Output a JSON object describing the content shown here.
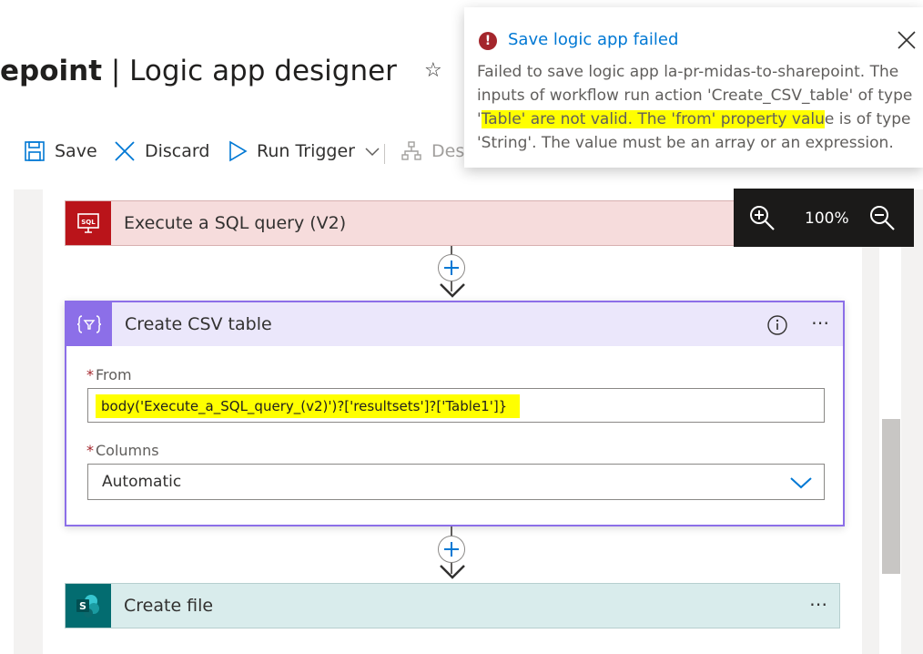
{
  "header": {
    "title_bold": "epoint",
    "title_rest": " | Logic app designer"
  },
  "toolbar": {
    "save_label": "Save",
    "discard_label": "Discard",
    "run_trigger_label": "Run Trigger",
    "designer_label": "Desi"
  },
  "zoom": {
    "level": "100%"
  },
  "steps": {
    "sql": {
      "title": "Execute a SQL query (V2)",
      "icon": "sql-server-icon",
      "color": "#ba141a"
    },
    "csv": {
      "title": "Create CSV table",
      "icon": "data-operations-icon",
      "color": "#8c6fe8",
      "from_label": "From",
      "from_value": "body('Execute_a_SQL_query_(v2)')?['resultsets']?['Table1']}",
      "columns_label": "Columns",
      "columns_value": "Automatic",
      "required_marker": "*"
    },
    "file": {
      "title": "Create file",
      "icon": "sharepoint-icon",
      "color": "#036c70"
    }
  },
  "notification": {
    "title": "Save logic app failed",
    "error_glyph": "!",
    "msg_part1": "Failed to save logic app la-pr-midas-to-sharepoint. The inputs of workflow run action 'Create_CSV_table' of type '",
    "msg_highlight": "Table' are not valid. The 'from' property valu",
    "msg_part2": "e is of type 'String'. The value must be an array or an expression."
  },
  "icons": {
    "favorite": "star-icon",
    "more": "⋯"
  }
}
